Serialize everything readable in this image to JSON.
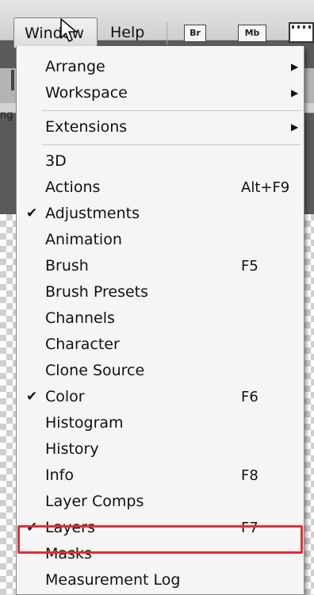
{
  "menubar": {
    "window_label": "Window",
    "help_label": "Help",
    "bridge_label": "Br",
    "minibridge_label": "Mb"
  },
  "background": {
    "cut_text": "ng"
  },
  "menu": {
    "group1": [
      {
        "label": "Arrange",
        "submenu": true
      },
      {
        "label": "Workspace",
        "submenu": true
      }
    ],
    "group2": [
      {
        "label": "Extensions",
        "submenu": true
      }
    ],
    "items": [
      {
        "label": "3D",
        "checked": false,
        "shortcut": ""
      },
      {
        "label": "Actions",
        "checked": false,
        "shortcut": "Alt+F9"
      },
      {
        "label": "Adjustments",
        "checked": true,
        "shortcut": ""
      },
      {
        "label": "Animation",
        "checked": false,
        "shortcut": ""
      },
      {
        "label": "Brush",
        "checked": false,
        "shortcut": "F5"
      },
      {
        "label": "Brush Presets",
        "checked": false,
        "shortcut": ""
      },
      {
        "label": "Channels",
        "checked": false,
        "shortcut": ""
      },
      {
        "label": "Character",
        "checked": false,
        "shortcut": ""
      },
      {
        "label": "Clone Source",
        "checked": false,
        "shortcut": ""
      },
      {
        "label": "Color",
        "checked": true,
        "shortcut": "F6"
      },
      {
        "label": "Histogram",
        "checked": false,
        "shortcut": ""
      },
      {
        "label": "History",
        "checked": false,
        "shortcut": ""
      },
      {
        "label": "Info",
        "checked": false,
        "shortcut": "F8"
      },
      {
        "label": "Layer Comps",
        "checked": false,
        "shortcut": ""
      },
      {
        "label": "Layers",
        "checked": true,
        "shortcut": "F7"
      },
      {
        "label": "Masks",
        "checked": false,
        "shortcut": ""
      },
      {
        "label": "Measurement Log",
        "checked": false,
        "shortcut": ""
      }
    ],
    "check_glyph": "✔",
    "arrow_glyph": "▶",
    "highlight_color": "#e03035"
  }
}
